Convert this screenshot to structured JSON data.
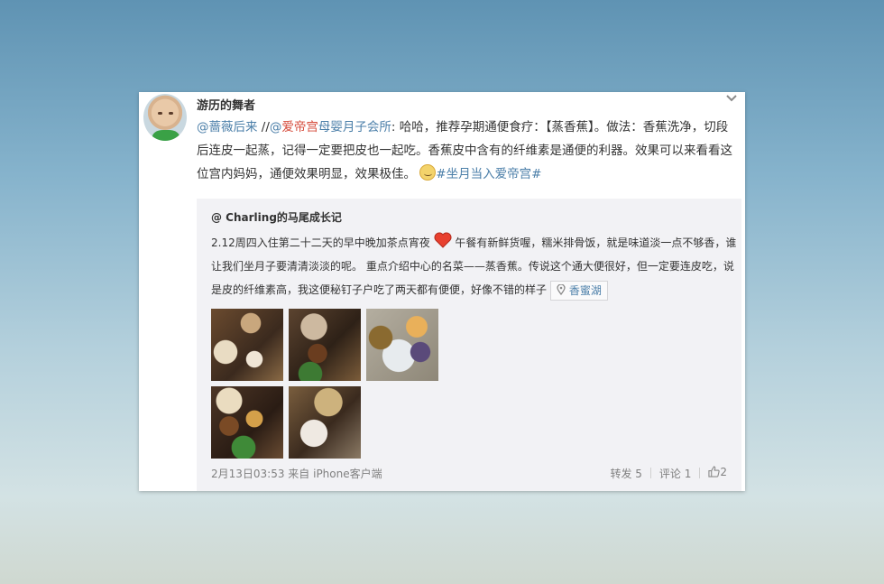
{
  "post": {
    "author": "游历的舞者",
    "mention1": "@蔷薇后来",
    "sep": " //",
    "mention2_at": "@",
    "mention2_brand": "爱帝宫",
    "mention2_rest": "母婴月子会所",
    "colon": ":",
    "text_before_emoji": " 哈哈，推荐孕期通便食疗：【蒸香蕉】。做法：香蕉洗净，切段后连皮一起蒸，记得一定要把皮也一起吃。香蕉皮中含有的纤维素是通便的利器。效果可以来看看这位宫内妈妈，通便效果明显，效果极佳。",
    "emoji": "doge-emoji",
    "hashtag": "#坐月当入爱帝宫#"
  },
  "repost": {
    "author": "@ Charling的马尾成长记",
    "text_part1": "2.12周四入住第二十二天的早中晚加茶点宵夜",
    "text_part2": " 午餐有新鲜货喔，糯米排骨饭，就是味道淡一点不够香，谁让我们坐月子要清清淡淡的呢。 重点介绍中心的名菜——蒸香蕉。传说这个通大便很好，但一定要连皮吃，说是皮的纤维素高，我这便秘钉子户吃了两天都有便便，好像不错的样子",
    "location": "香蜜湖",
    "images": [
      "meal-photo-1",
      "meal-photo-2",
      "meal-photo-3",
      "meal-photo-4",
      "meal-photo-5"
    ],
    "timestamp": "2月13日03:53 来自 iPhone客户端",
    "forward": "转发 5",
    "comment": "评论 1",
    "likes": "2"
  },
  "colors": {
    "link": "#4a7ea8",
    "brand": "#d54a3a",
    "card_bg": "#ffffff",
    "repost_bg": "#f2f2f5"
  }
}
